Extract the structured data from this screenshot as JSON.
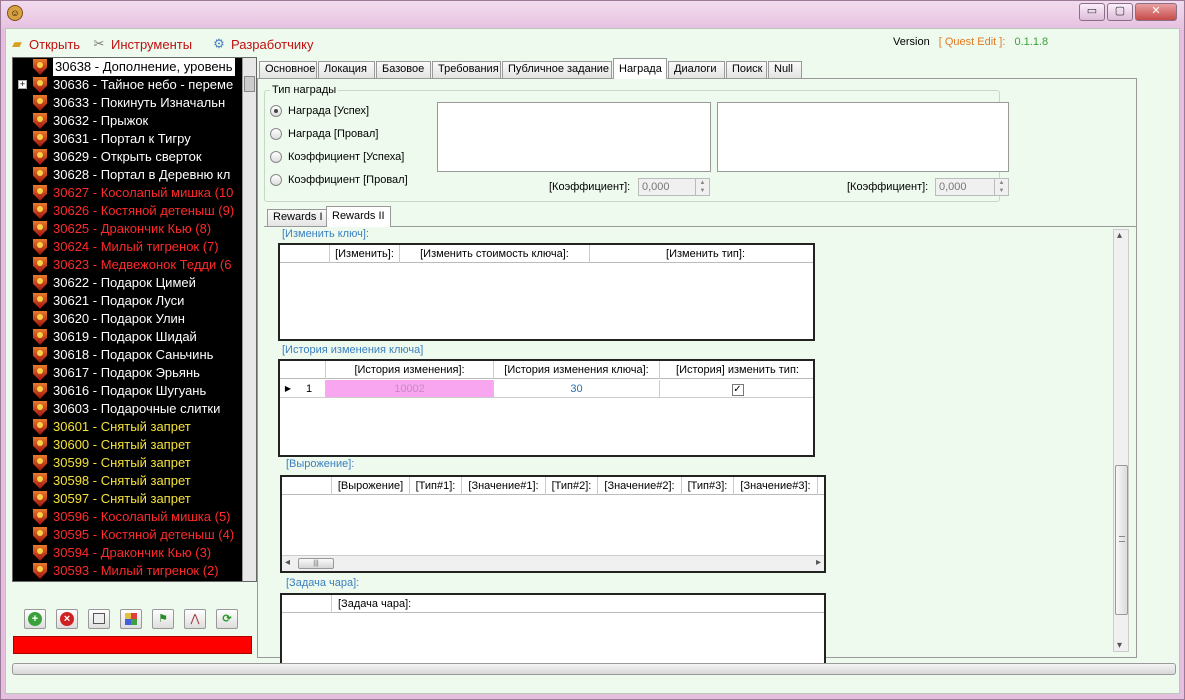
{
  "window": {
    "min_btn": "▭",
    "max_btn": "▢",
    "close_btn": "✕"
  },
  "menu": {
    "open": "Открыть",
    "tools": "Инструменты",
    "developer": "Разработчику"
  },
  "version": {
    "label": "Version",
    "app": "[ Quest Edit ]:",
    "number": "0.1.1.8"
  },
  "tree": {
    "items": [
      {
        "text": "30638 - Дополнение, уровень",
        "color": "#000000",
        "selected": true
      },
      {
        "text": "30636 - Тайное небо - переме",
        "color": "#ffffff",
        "expander": "+"
      },
      {
        "text": "30633 - Покинуть Изначальн",
        "color": "#ffffff"
      },
      {
        "text": "30632 - Прыжок",
        "color": "#ffffff"
      },
      {
        "text": "30631 - Портал к Тигру",
        "color": "#ffffff"
      },
      {
        "text": "30629 - Открыть сверток",
        "color": "#ffffff"
      },
      {
        "text": "30628 - Портал в Деревню кл",
        "color": "#ffffff"
      },
      {
        "text": "30627 - Косолапый мишка (10",
        "color": "#ff2a2a"
      },
      {
        "text": "30626 - Костяной детеныш (9)",
        "color": "#ff2a2a"
      },
      {
        "text": "30625 - Дракончик Кью (8)",
        "color": "#ff2a2a"
      },
      {
        "text": "30624 - Милый тигренок (7)",
        "color": "#ff2a2a"
      },
      {
        "text": "30623 - Медвежонок Тедди (6",
        "color": "#ff2a2a"
      },
      {
        "text": "30622 - Подарок Цимей",
        "color": "#ffffff"
      },
      {
        "text": "30621 - Подарок Луси",
        "color": "#ffffff"
      },
      {
        "text": "30620 - Подарок Улин",
        "color": "#ffffff"
      },
      {
        "text": "30619 - Подарок Шидай",
        "color": "#ffffff"
      },
      {
        "text": "30618 - Подарок Саньчинь",
        "color": "#ffffff"
      },
      {
        "text": "30617 - Подарок Эрьянь",
        "color": "#ffffff"
      },
      {
        "text": "30616 - Подарок Шугуань",
        "color": "#ffffff"
      },
      {
        "text": "30603 - Подарочные слитки",
        "color": "#ffffff"
      },
      {
        "text": "30601 - Снятый запрет",
        "color": "#f5e23a"
      },
      {
        "text": "30600 - Снятый запрет",
        "color": "#f5e23a"
      },
      {
        "text": "30599 - Снятый запрет",
        "color": "#f5e23a"
      },
      {
        "text": "30598 - Снятый запрет",
        "color": "#f5e23a"
      },
      {
        "text": "30597 - Снятый запрет",
        "color": "#f5e23a"
      },
      {
        "text": "30596 - Косолапый мишка (5)",
        "color": "#ff2a2a"
      },
      {
        "text": "30595 - Костяной детеныш (4)",
        "color": "#ff2a2a"
      },
      {
        "text": "30594 - Дракончик Кью (3)",
        "color": "#ff2a2a"
      },
      {
        "text": "30593 - Милый тигренок (2)",
        "color": "#ff2a2a"
      }
    ]
  },
  "tabs": [
    "Основное",
    "Локация",
    "Базовое",
    "Требования",
    "Публичное задание",
    "Награда",
    "Диалоги",
    "Поиск",
    "Null"
  ],
  "active_tab": "Награда",
  "reward_type": {
    "title": "Тип награды",
    "options": [
      "Награда [Успех]",
      "Награда [Провал]",
      "Коэффициент [Успеха]",
      "Коэффициент [Провал]"
    ],
    "selected": "Награда [Успех]",
    "coef_label": "[Коэффициент]:",
    "coef_value_1": "0,000",
    "coef_value_2": "0,000"
  },
  "subtabs": [
    "Rewards I",
    "Rewards II"
  ],
  "active_subtab": "Rewards II",
  "change_key": {
    "title": "[Изменить ключ]:",
    "columns": [
      "[Изменить]:",
      "[Изменить стоимость ключа]:",
      "[Изменить тип]:"
    ]
  },
  "key_history": {
    "title": "[История изменения ключа]",
    "columns": [
      "[История изменения]:",
      "[История изменения ключа]:",
      "[История] изменить тип:"
    ],
    "rows": [
      {
        "num": "1",
        "change": "10002",
        "key": "30",
        "checked": "✓"
      }
    ],
    "row_marker": "▶"
  },
  "expression": {
    "title": "[Вырожение]:",
    "columns": [
      "[Вырожение]",
      "[Тип#1]:",
      "[Значение#1]:",
      "[Тип#2]:",
      "[Значение#2]:",
      "[Тип#3]:",
      "[Значение#3]:"
    ]
  },
  "spell_task": {
    "title": "[Задача чара]:",
    "columns": [
      "[Задача чара]:"
    ]
  },
  "scroll": {
    "left": "◂",
    "right": "▸",
    "up": "▴",
    "down": "▾"
  },
  "colors": {
    "selection_pink": "#f7a6ef",
    "menu_red": "#c01010",
    "version_orange": "#e07a20",
    "version_green": "#3aa03a"
  }
}
